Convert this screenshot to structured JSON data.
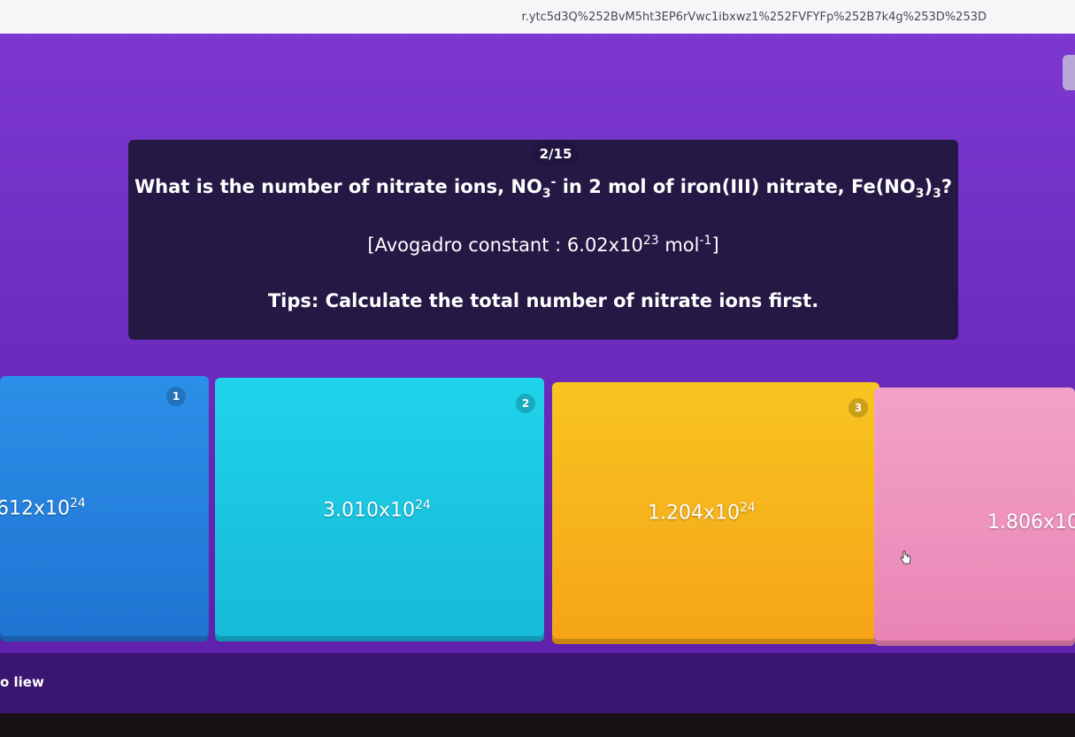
{
  "browser": {
    "url_fragment": "r.ytc5d3Q%252BvM5ht3EP6rVwc1ibxwz1%252FVFYFp%252B7k4g%253D%253D"
  },
  "quiz": {
    "counter": "2/15",
    "question": {
      "prefix": "What is the number of nitrate ions, NO",
      "no3_sub": "3",
      "no3_sup": "-",
      "middle": " in 2 mol of iron(III) nitrate, Fe(NO",
      "fe_sub_inner": "3",
      "close_paren": ")",
      "fe_sub_outer": "3",
      "suffix": "?"
    },
    "avogadro": {
      "prefix": "[Avogadro constant : 6.02x10",
      "exponent": "23",
      "unit": " mol",
      "unit_exp": "-1",
      "suffix": "]"
    },
    "tip": "Tips: Calculate the total number of nitrate ions first.",
    "options": [
      {
        "number": "1",
        "mantissa": "612x10",
        "exponent": "24",
        "color": "#2b8fe8"
      },
      {
        "number": "2",
        "mantissa": "3.010x10",
        "exponent": "24",
        "color": "#1fd3ea"
      },
      {
        "number": "3",
        "mantissa": "1.204x10",
        "exponent": "24",
        "color": "#f8c520"
      },
      {
        "number": "",
        "mantissa": "1.806x10",
        "exponent": "",
        "color": "#f2a2c9"
      }
    ]
  },
  "footer": {
    "label": "o liew"
  }
}
